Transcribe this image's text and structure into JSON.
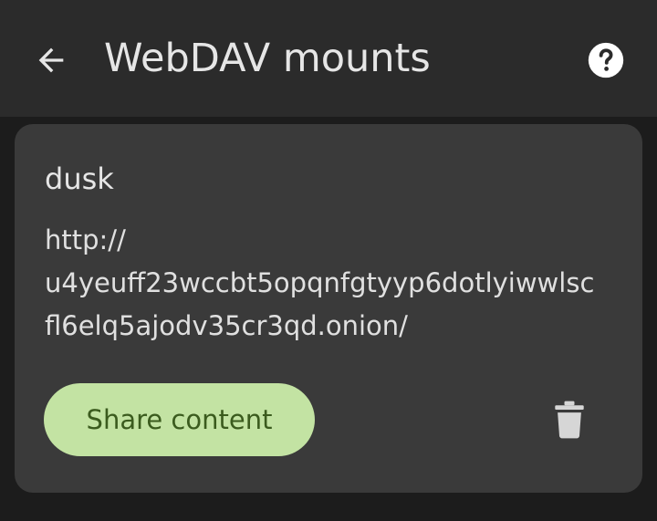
{
  "header": {
    "title": "WebDAV mounts",
    "back_icon": "arrow-left-icon",
    "help_icon": "help-circle-icon"
  },
  "mount": {
    "name": "dusk",
    "url": "http://\nu4yeuff23wccbt5opqnfgtyyp6dotlyiwwlsc\nfl6elq5ajodv35cr3qd.onion/",
    "share_label": "Share content",
    "delete_icon": "trash-icon"
  },
  "colors": {
    "background": "#1c1c1c",
    "app_bar": "#2b2b2b",
    "card": "#3a3a3a",
    "primary_container": "#c3e3a3",
    "on_primary_container": "#3b5b1e",
    "text": "#e6e6e6"
  }
}
